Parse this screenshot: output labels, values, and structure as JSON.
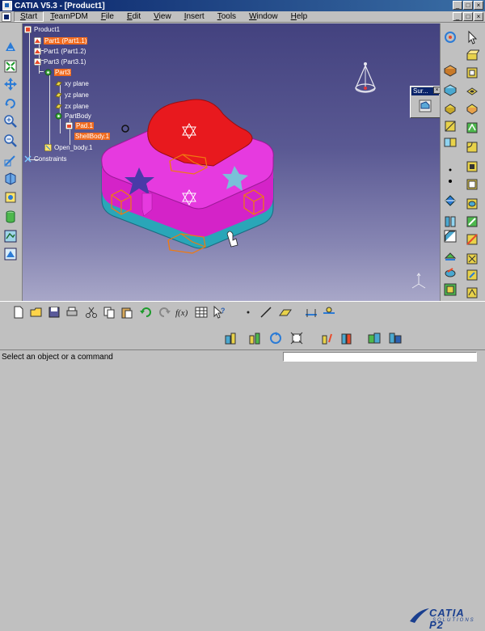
{
  "window": {
    "title": "CATIA V5.3 - [Product1]"
  },
  "menu": {
    "items": [
      {
        "label": "Start",
        "ul": "S",
        "rest": "tart"
      },
      {
        "label": "TeamPDM",
        "ul": "T",
        "rest": "eamPDM"
      },
      {
        "label": "File",
        "ul": "F",
        "rest": "ile"
      },
      {
        "label": "Edit",
        "ul": "E",
        "rest": "dit"
      },
      {
        "label": "View",
        "ul": "V",
        "rest": "iew"
      },
      {
        "label": "Insert",
        "ul": "I",
        "rest": "nsert"
      },
      {
        "label": "Tools",
        "ul": "T",
        "rest": "ools"
      },
      {
        "label": "Window",
        "ul": "W",
        "rest": "indow"
      },
      {
        "label": "Help",
        "ul": "H",
        "rest": "elp"
      }
    ]
  },
  "tree": {
    "product": "Product1",
    "part1_1": "Part1 (Part1.1)",
    "part1_2": "Part1 (Part1.2)",
    "part3_1": "Part3 (Part3.1)",
    "part3": "Part3",
    "xy_plane": "xy plane",
    "yz_plane": "yz plane",
    "zx_plane": "zx plane",
    "partbody": "PartBody",
    "pad1": "Pad.1",
    "pad_sub": "ShellBody.1",
    "open_body": "Open_body.1",
    "constraints": "Constraints"
  },
  "float_panel": {
    "title": "Sur..."
  },
  "logo": {
    "text": "CATIA P2",
    "sub": "SOLUTIONS"
  },
  "status": {
    "text": "Select an object or a command",
    "command_value": ""
  },
  "colors": {
    "box_top": "#e426d8",
    "box_side": "#2aa6b8",
    "heart": "#e8191e",
    "highlight": "#f06a1e",
    "wireframe": "#f07a10"
  }
}
